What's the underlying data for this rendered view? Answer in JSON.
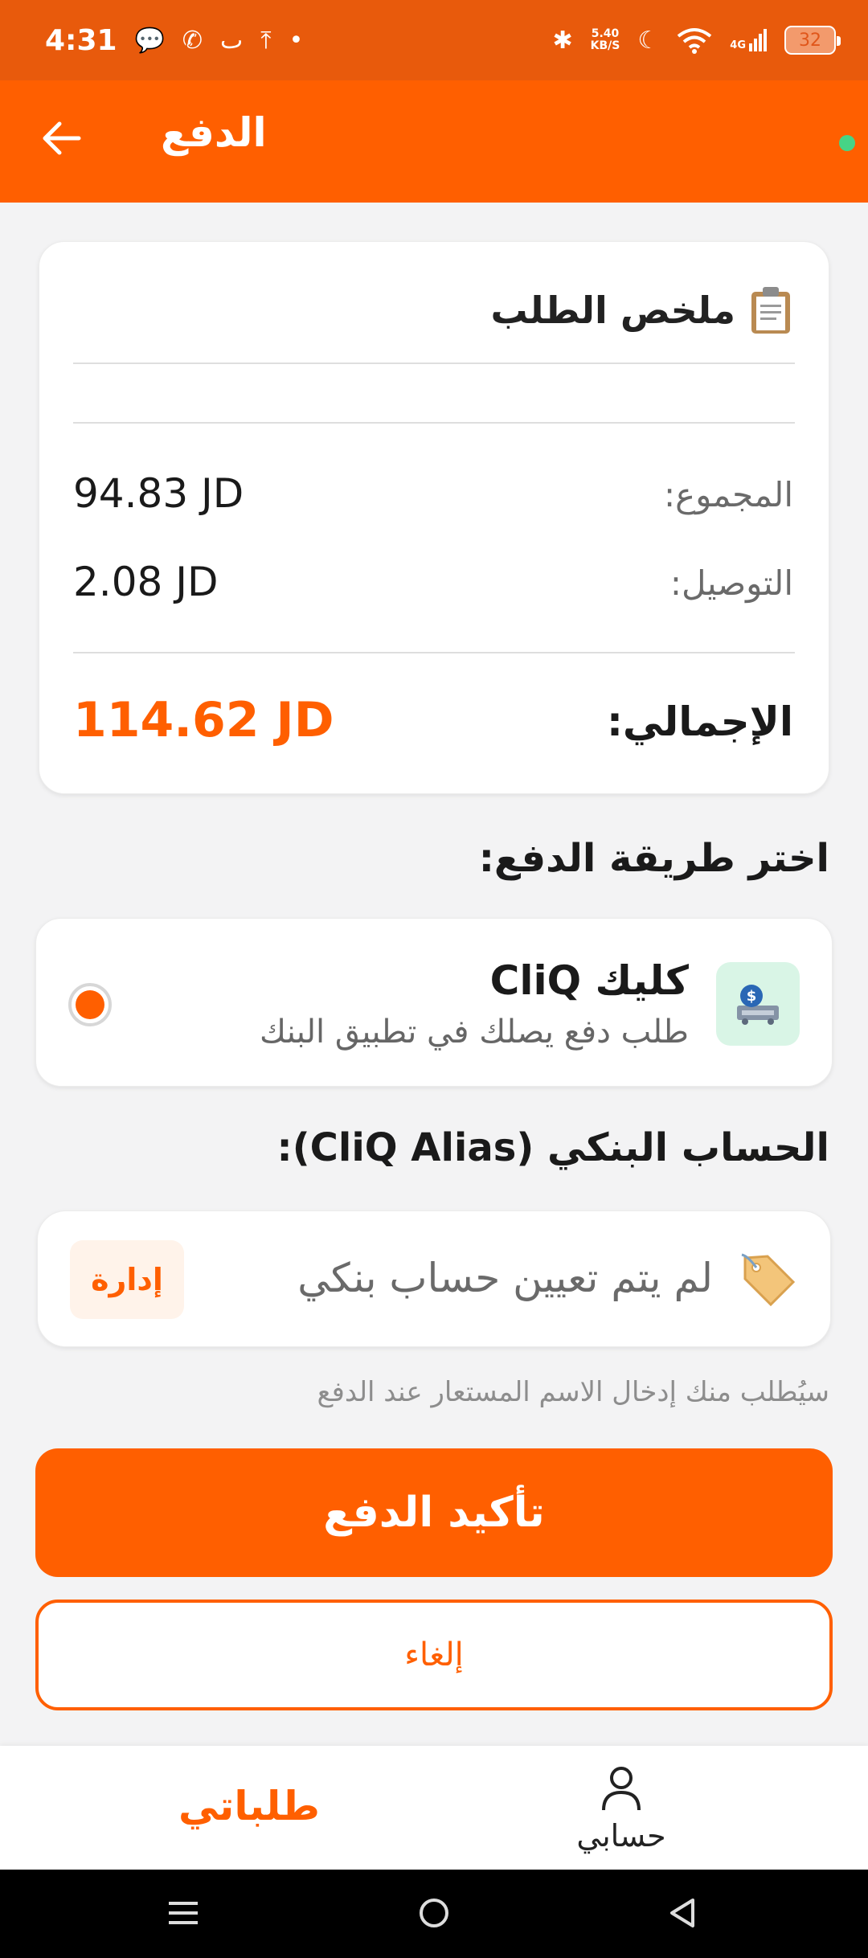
{
  "status_bar": {
    "time": "4:31",
    "net_speed_value": "5.40",
    "net_speed_unit": "KB/S",
    "network_type": "4G",
    "battery": "32"
  },
  "app_bar": {
    "title": "الدفع"
  },
  "summary": {
    "title": "ملخص الطلب",
    "subtotal_label": "المجموع:",
    "subtotal_value": "94.83 JD",
    "delivery_label": "التوصيل:",
    "delivery_value": "2.08 JD",
    "total_label": "الإجمالي:",
    "total_value": "114.62 JD"
  },
  "payment": {
    "section_title": "اختر طريقة الدفع:",
    "method_name": "كليك CliQ",
    "method_desc": "طلب دفع يصلك في تطبيق البنك"
  },
  "alias": {
    "section_title": "الحساب البنكي (CliQ Alias):",
    "empty_text": "لم يتم تعيين حساب بنكي",
    "manage_label": "إدارة",
    "hint": "سيُطلب منك إدخال الاسم المستعار عند الدفع"
  },
  "actions": {
    "confirm_label": "تأكيد الدفع",
    "cancel_label": "إلغاء"
  },
  "bottom_nav": {
    "account_label": "حسابي",
    "orders_label": "طلباتي"
  },
  "colors": {
    "accent": "#ff5f00",
    "status_bar": "#e85a0c",
    "live_indicator": "#46d486"
  }
}
